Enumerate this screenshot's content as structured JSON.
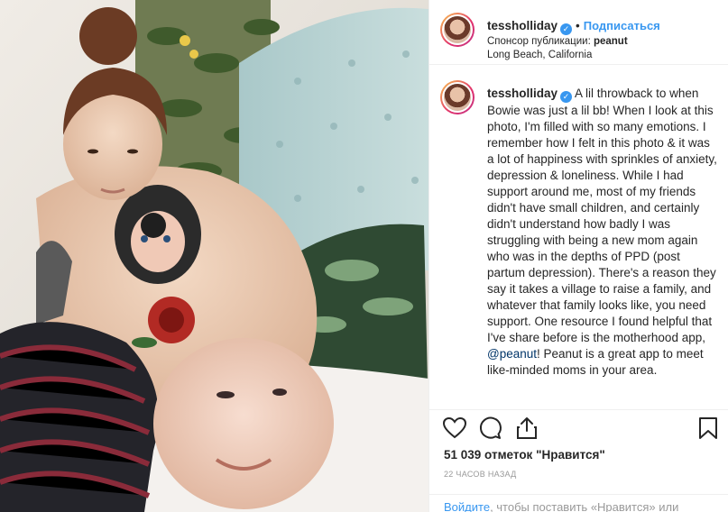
{
  "post": {
    "username": "tessholliday",
    "follow_label": "Подписаться",
    "sponsor_prefix": "Спонсор публикации:",
    "sponsor_name": "peanut",
    "location": "Long Beach, California",
    "caption_username": "tessholliday",
    "caption_text": "A lil throwback to when Bowie was just a lil bb! When I look at this photo, I'm filled with so many emotions. I remember how I felt in this photo & it was a lot of happiness with sprinkles of anxiety, depression & loneliness. While I had support around me, most of my friends didn't have small children, and certainly didn't understand how badly I was struggling with being a new mom again who was in the depths of PPD (post partum depression). There's a reason they say it takes a village to raise a family, and whatever that family looks like, you need support. One resource I found helpful that I've share before is the motherhood app,",
    "caption_mention": "@peanut",
    "caption_text_after": "! Peanut is a great app to meet like-minded moms in your area.",
    "likes": "51 039 отметок \"Нравится\"",
    "time": "22 ЧАСОВ НАЗАД",
    "login_link": "Войдите",
    "login_text": ", чтобы поставить «Нравится» или"
  },
  "icons": {
    "verified": "verified-badge",
    "like": "heart-icon",
    "comment": "comment-icon",
    "share": "share-icon",
    "save": "bookmark-icon"
  },
  "colors": {
    "accent": "#3897f0",
    "text": "#262626",
    "muted": "#999999",
    "border": "#efefef"
  }
}
